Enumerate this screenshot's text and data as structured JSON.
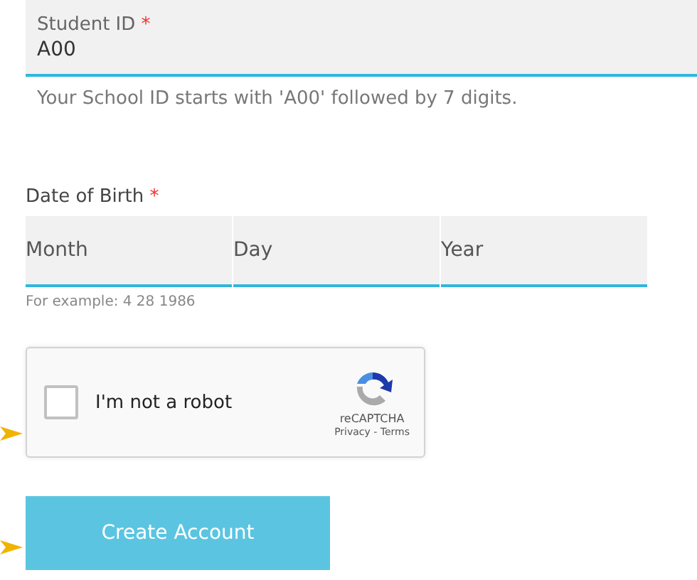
{
  "student_id": {
    "label": "Student ID",
    "required_mark": "*",
    "value": "A00",
    "help": "Your School ID starts with 'A00' followed by 7 digits."
  },
  "date_of_birth": {
    "label": "Date of Birth",
    "required_mark": "*",
    "fields": [
      {
        "placeholder": "Month"
      },
      {
        "placeholder": "Day"
      },
      {
        "placeholder": "Year"
      }
    ],
    "help": "For example: 4 28 1986"
  },
  "captcha": {
    "label": "I'm not a robot",
    "checked": false,
    "brand": "reCAPTCHA",
    "links": "Privacy - Terms"
  },
  "submit": {
    "label": "Create Account"
  }
}
